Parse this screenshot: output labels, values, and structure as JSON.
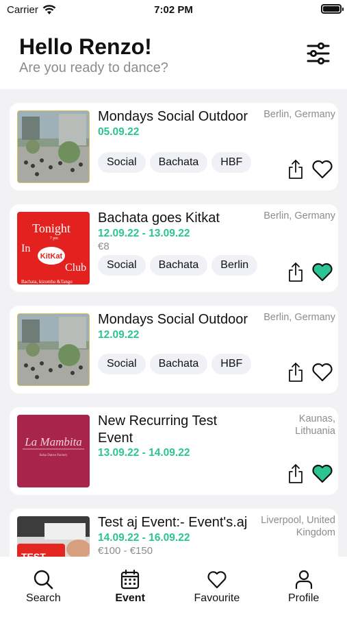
{
  "status": {
    "carrier": "Carrier",
    "time": "7:02 PM"
  },
  "header": {
    "greeting": "Hello Renzo!",
    "subtitle": "Are you ready to dance?"
  },
  "events": [
    {
      "title": "Mondays Social Outdoor",
      "date": "05.09.22",
      "location": "Berlin, Germany",
      "tags": [
        "Social",
        "Bachata",
        "HBF"
      ],
      "favourite": false,
      "thumb": "outdoor"
    },
    {
      "title": "Bachata goes Kitkat",
      "date": "12.09.22 - 13.09.22",
      "price": "€8",
      "location": "Berlin, Germany",
      "tags": [
        "Social",
        "Bachata",
        "Berlin"
      ],
      "favourite": true,
      "thumb": "kitkat",
      "thumb_text": {
        "line1": "Tonight",
        "line2": "7 pm",
        "line3": "In",
        "line4": "KitKat",
        "line5": "Club",
        "line6": "Bachata, kizomba &Tango"
      }
    },
    {
      "title": "Mondays Social Outdoor",
      "date": "12.09.22",
      "location": "Berlin, Germany",
      "tags": [
        "Social",
        "Bachata",
        "HBF"
      ],
      "favourite": false,
      "thumb": "outdoor"
    },
    {
      "title": "New Recurring Test Event",
      "date": "13.09.22 - 14.09.22",
      "location": "Kaunas, Lithuania",
      "tags": [],
      "favourite": true,
      "thumb": "mambita",
      "thumb_text": {
        "line1": "La Mambita",
        "line2": "Salsa Dance Factory"
      }
    },
    {
      "title": "Test aj Event:- Event's.aj",
      "date": "14.09.22 - 16.09.22",
      "price": "€100 - €150",
      "location": "Liverpool, United Kingdom",
      "tags": [],
      "favourite": false,
      "thumb": "test",
      "thumb_text": {
        "line1": "TEST"
      }
    }
  ],
  "nav": [
    {
      "label": "Search",
      "icon": "search-icon",
      "active": false
    },
    {
      "label": "Event",
      "icon": "calendar-icon",
      "active": true
    },
    {
      "label": "Favourite",
      "icon": "heart-icon",
      "active": false
    },
    {
      "label": "Profile",
      "icon": "person-icon",
      "active": false
    }
  ],
  "colors": {
    "accent": "#2bc493",
    "muted": "#8c8c8c",
    "tag_bg": "#f0f1f6",
    "kitkat_red": "#e3221f",
    "mambita": "#a8244a"
  }
}
